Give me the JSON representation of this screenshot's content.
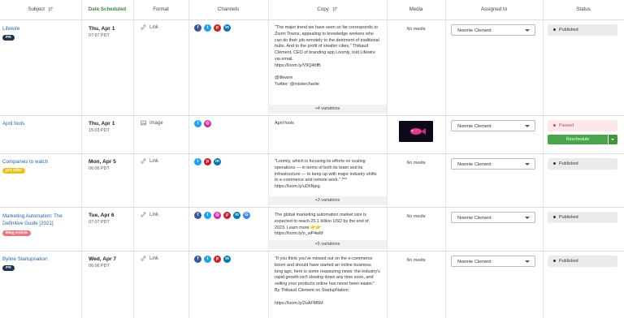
{
  "headers": {
    "subject": "Subject",
    "date": "Date Scheduled",
    "format": "Format",
    "channels": "Channels",
    "copy": "Copy",
    "media": "Media",
    "assigned": "Assigned to",
    "status": "Status"
  },
  "colors": {
    "facebook": "#3b5998",
    "twitter": "#1da1f2",
    "pinterest": "#cb2027",
    "linkedin": "#0077b5",
    "instagram": "#d6249f",
    "google": "#4285f4",
    "green": "#4aa44a"
  },
  "rows": [
    {
      "subject": "Lifewire",
      "tag": "PR",
      "date": "Thu, Apr 1",
      "time": "07:07 PDT",
      "format": "Link",
      "channels": [
        "facebook",
        "twitter",
        "pinterest",
        "linkedin"
      ],
      "copy": "\"The major trend we have seen so far corresponds to Zoom Towns, appealing to knowledge workers who can do their job remotely to the detriment of traditional hubs. And to the profit of smaller cities,\" Thibaud Clément, CEO of branding app Loomly, told Lifewire via email.\nhttps://loom.ly/V9Q4bfB\n\n@lifewire\nTwitter: @mistercharlie",
      "variations": "+4 variations",
      "media": "No media",
      "assigned": "Noemie Clement",
      "status": "Published"
    },
    {
      "subject": "April fools",
      "tag": "",
      "date": "Thu, Apr 1",
      "time": "15:03 PDT",
      "format": "Image",
      "channels": [
        "twitter",
        "instagram"
      ],
      "copy": "April fools",
      "variations": "",
      "media": "",
      "assigned": "Noemie Clement",
      "status": "Passed",
      "action": "Reschedule"
    },
    {
      "subject": "Companies to watch",
      "tag": "pro offer",
      "date": "Mon, Apr 5",
      "time": "06:06 PDT",
      "format": "Link",
      "channels": [
        "twitter",
        "pinterest",
        "linkedin"
      ],
      "copy": "\"Loomly, which is focusing its efforts on scaling operations — in terms of both its team and its infrastructure — to keep up with major industry shifts to e-commerce and remote work.\" *** https://loom.ly/uDhNjeg",
      "variations": "+3 variations",
      "media": "No media",
      "assigned": "Noemie Clement",
      "status": "Published"
    },
    {
      "subject": "Marketing Automation: The Definitive Guide [2021]",
      "tag": "Blog Article",
      "date": "Tue, Apr 6",
      "time": "07:07 PDT",
      "format": "Link",
      "channels": [
        "facebook",
        "twitter",
        "instagram",
        "pinterest",
        "linkedin",
        "google"
      ],
      "copy": "The global marketing automation market size is expected to reach 25.1 billion USD by the end of 2023. Learn more 👉👉\nhttps://loom.ly/o_wP4wM",
      "variations": "+5 variations",
      "media": "No media",
      "assigned": "Noemie Clement",
      "status": "Published"
    },
    {
      "subject": "Byline Startupnation",
      "tag": "PR",
      "date": "Wed, Apr 7",
      "time": "06:06 PDT",
      "format": "Link",
      "channels": [
        "facebook",
        "twitter",
        "pinterest",
        "linkedin"
      ],
      "copy": "\"If you think you've missed out on the e-commerce boom and should have started an online business long ago, here is some reassuring news: the industry's rapid growth isn't slowing down any time soon, and selling your products online has never been easier.\" By Thibaud Clement on StartupNation\n\nhttps://loom.ly/2uAFM6M",
      "variations": "",
      "media": "No media",
      "assigned": "Noemie Clement",
      "status": "Published"
    }
  ]
}
